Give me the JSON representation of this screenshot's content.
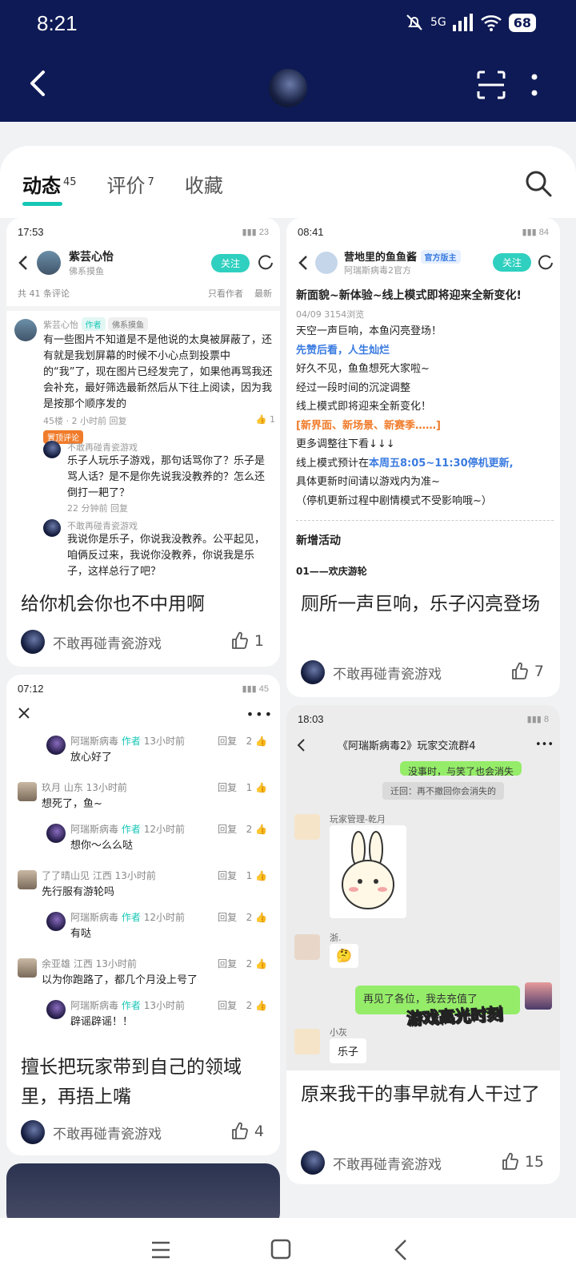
{
  "status": {
    "time": "8:21",
    "network": "5G",
    "battery": "68"
  },
  "header": {
    "avatar_alt": "game avatar"
  },
  "tabs": [
    {
      "label": "动态",
      "count": "45"
    },
    {
      "label": "评价",
      "count": "7"
    },
    {
      "label": "收藏",
      "count": ""
    }
  ],
  "cards": {
    "c1": {
      "shot": {
        "time": "17:53",
        "battery": "23",
        "user": "紫芸心怡",
        "sub": "佛系摸鱼",
        "follow": "关注",
        "total": "共 41 条评论",
        "only_author": "只看作者",
        "latest": "最新",
        "c_user": "紫芸心怡",
        "c_tag1": "作者",
        "c_tag2": "佛系摸鱼",
        "c_text": "有一些图片不知道是不是他说的太臭被屏蔽了，还有就是我划屏幕的时候不小心点到投票中的“我”了，现在图片已经发完了，如果他再骂我还会补充，最好筛选最新然后从下往上阅读，因为我是按那个顺序发的",
        "c_meta": "45楼 · 2 小时前 回复",
        "c_like": "1",
        "pin": "置顶评论",
        "r1_user": "不敢再碰青瓷游戏",
        "r1_text": "乐子人玩乐子游戏，那句话骂你了？乐子是骂人话？是不是你先说我没教养的？怎么还倒打一耙了？",
        "r1_meta": "22 分钟前 回复",
        "r2_user": "不敢再碰青瓷游戏",
        "r2_text": "我说你是乐子，你说我没教养。公平起见，咱俩反过来，我说你没教养，你说我是乐子，这样总行了吧？"
      },
      "caption": "给你机会你也不中用啊",
      "author": "不敢再碰青瓷游戏",
      "likes": "1"
    },
    "c2": {
      "shot": {
        "time": "08:41",
        "battery": "84",
        "user": "营地里的鱼鱼酱",
        "official": "官方版主",
        "sub": "阿瑞斯病毒2官方",
        "follow": "关注",
        "title": "新面貌~新体验~线上模式即将迎来全新变化!",
        "meta": "04/09 3154浏览",
        "l1": "天空一声巨响，本鱼闪亮登场！",
        "l2": "先赞后看，人生灿烂",
        "l3": "好久不见，鱼鱼想死大家啦~",
        "l4": "经过一段时间的沉淀调整",
        "l5": "线上模式即将迎来全新变化！",
        "l6a": "[",
        "l6b": "新界面、新场景、新赛季……",
        "l6c": "]",
        "l7": "更多调整往下看↓↓↓",
        "l8a": "线上模式预计在",
        "l8b": "本周五8:05~11:30停机更新,",
        "l9": "具体更新时间请以游戏内为准~",
        "l10": "（停机更新过程中剧情模式不受影响哦~）",
        "h1": "新增活动",
        "h2": "01——欢庆游轮"
      },
      "caption": "厕所一声巨响，乐子闪亮登场",
      "author": "不敢再碰青瓷游戏",
      "likes": "7"
    },
    "c3": {
      "shot": {
        "time": "07:12",
        "battery": "45",
        "rows": [
          {
            "user": "阿瑞斯病毒",
            "tag": "作者",
            "time": "13小时前",
            "text": "放心好了",
            "likes": "2",
            "reply": true
          },
          {
            "user": "玖月  山东",
            "tag": "",
            "time": "13小时前",
            "text": "想死了，鱼~",
            "likes": "1",
            "reply": false
          },
          {
            "user": "阿瑞斯病毒",
            "tag": "作者",
            "time": "12小时前",
            "text": "想你～么么哒",
            "likes": "2",
            "reply": true
          },
          {
            "user": "了了晴山见  江西",
            "tag": "",
            "time": "13小时前",
            "text": "先行服有游轮吗",
            "likes": "1",
            "reply": false
          },
          {
            "user": "阿瑞斯病毒",
            "tag": "作者",
            "time": "12小时前",
            "text": "有哒",
            "likes": "2",
            "reply": true
          },
          {
            "user": "余亚雄  江西",
            "tag": "",
            "time": "13小时前",
            "text": "以为你跑路了，都几个月没上号了",
            "likes": "2",
            "reply": false
          },
          {
            "user": "阿瑞斯病毒",
            "tag": "作者",
            "time": "13小时前",
            "text": "辟谣辟谣！！",
            "likes": "2",
            "reply": true
          }
        ],
        "reply_label": "回复"
      },
      "caption": "擅长把玩家带到自己的领域里，再捂上嘴",
      "author": "不敢再碰青瓷游戏",
      "likes": "4"
    },
    "c4": {
      "shot": {
        "time": "18:03",
        "battery": "8",
        "group": "《阿瑞斯病毒2》玩家交流群4",
        "bubble_top": "没事时，与笑了也会消失",
        "recall": "迁回：再不撤回你会消失的",
        "u1": "玩家管理-乾月",
        "u2": "浙.",
        "green": "再见了各位，我去充值了",
        "overlay": "游戏高光时刻",
        "u3": "小灰",
        "msg3": "乐子"
      },
      "caption": "原来我干的事早就有人干过了",
      "author": "不敢再碰青瓷游戏",
      "likes": "15"
    }
  },
  "colors": {
    "header": "#0e1a55",
    "accent": "#16c7b6",
    "follow": "#2fd0bf"
  }
}
